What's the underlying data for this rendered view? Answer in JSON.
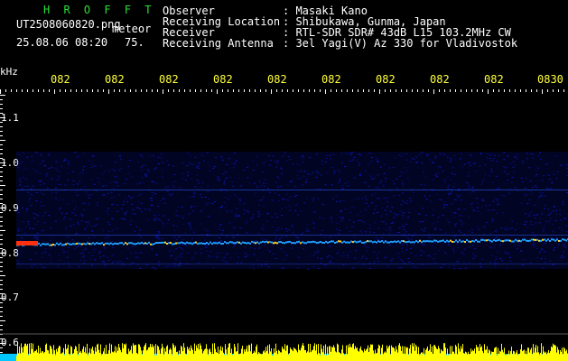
{
  "station": {
    "logo": "H R O F F T",
    "filename": "UT2508060820.png",
    "type": "meteor",
    "date": "25.08.06 08:20",
    "value": "75."
  },
  "meta": [
    {
      "label": "Observer",
      "value": ": Masaki Kano"
    },
    {
      "label": "Receiving Location",
      "value": ": Shibukawa, Gunma, Japan"
    },
    {
      "label": "Receiver",
      "value": ": RTL-SDR SDR# 43dB L15 103.2MHz CW"
    },
    {
      "label": "Receiving Antenna",
      "value": ": 3el Yagi(V) Az 330 for Vladivostok"
    }
  ],
  "axis": {
    "y_unit": "kHz",
    "y_ticks": [
      "1.1",
      "1.0",
      "0.9",
      "0.8",
      "0.7",
      "0.6"
    ],
    "x_ticks": [
      "082",
      "082",
      "082",
      "082",
      "082",
      "082",
      "082",
      "082",
      "082",
      "0830"
    ]
  },
  "colors": {
    "background": "#000000",
    "noise": "#0a18c8",
    "signal_line": "#1fa0ff",
    "hot": "#ff3010",
    "baseline": "#5a5a5a",
    "bottom_bars": "#ffff00",
    "bottom_fill": "#00c8ff"
  }
}
